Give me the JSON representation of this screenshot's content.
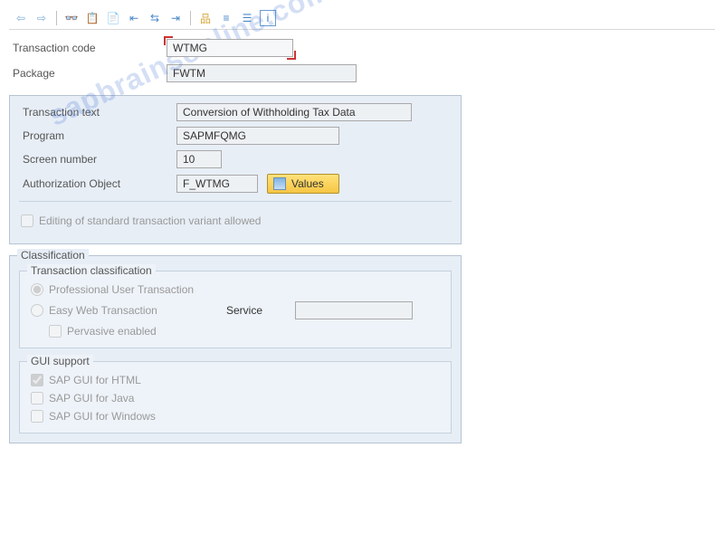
{
  "watermark": "sapbrainsonline.com",
  "fields": {
    "transaction_code_label": "Transaction code",
    "transaction_code_value": "WTMG",
    "package_label": "Package",
    "package_value": "FWTM",
    "transaction_text_label": "Transaction text",
    "transaction_text_value": "Conversion of Withholding Tax Data",
    "program_label": "Program",
    "program_value": "SAPMFQMG",
    "screen_number_label": "Screen number",
    "screen_number_value": "10",
    "auth_object_label": "Authorization Object",
    "auth_object_value": "F_WTMG",
    "values_button": "Values",
    "edit_variant_label": "Editing of standard transaction variant allowed"
  },
  "classification": {
    "legend": "Classification",
    "transaction_classification": {
      "legend": "Transaction classification",
      "professional": "Professional User Transaction",
      "easy_web": "Easy Web Transaction",
      "service_label": "Service",
      "service_value": "",
      "pervasive": "Pervasive enabled"
    },
    "gui_support": {
      "legend": "GUI support",
      "html": "SAP GUI for HTML",
      "java": "SAP GUI for Java",
      "windows": "SAP GUI for Windows"
    }
  }
}
